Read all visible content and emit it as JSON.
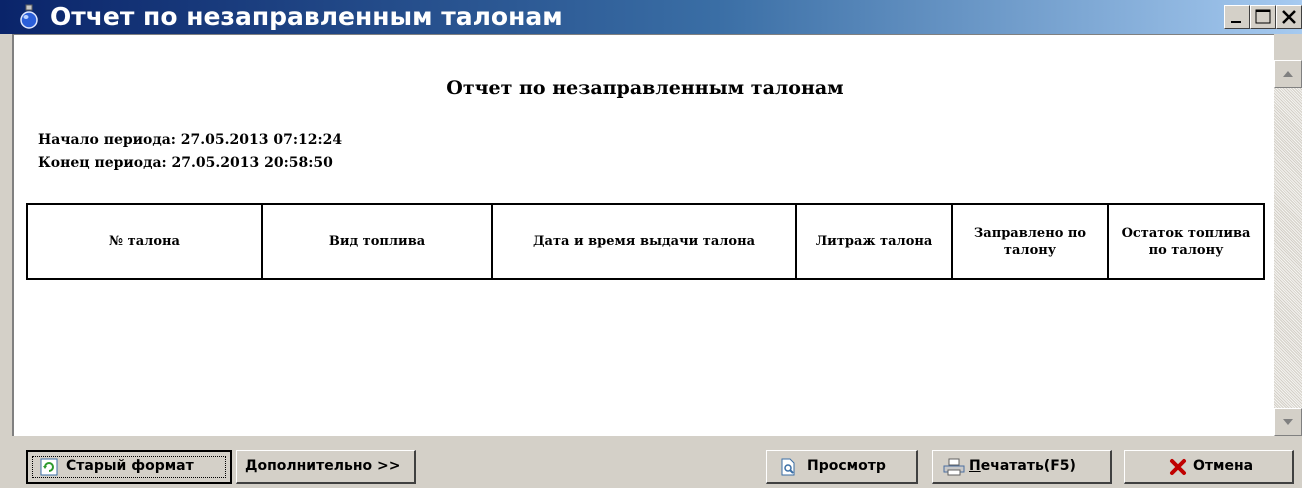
{
  "window": {
    "title": "Отчет по незаправленным талонам",
    "icon": "fuel-drop-icon"
  },
  "report": {
    "title": "Отчет по незаправленным талонам",
    "period_start": "Начало периода: 27.05.2013 07:12:24",
    "period_end": "Конец периода: 27.05.2013 20:58:50",
    "columns": [
      "№ талона",
      "Вид топлива",
      "Дата и время выдачи талона",
      "Литраж талона",
      "Заправлено по талону",
      "Остаток топлива по талону"
    ],
    "rows": []
  },
  "toolbar": {
    "old_format_label": "Старый формат",
    "more_label": "Дополнительно >>",
    "preview_label": "Просмотр",
    "print_label_mnemonic": "П",
    "print_label_rest": "ечатать(F5)",
    "cancel_label": "Отмена"
  },
  "colors": {
    "title_gradient_start": "#0a246a",
    "title_gradient_end": "#a6caf0",
    "cancel_icon": "#c00000"
  }
}
